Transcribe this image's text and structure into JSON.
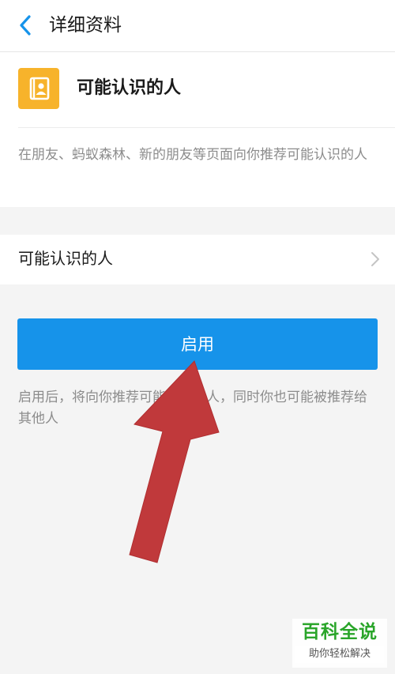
{
  "header": {
    "title": "详细资料"
  },
  "info_card": {
    "title": "可能认识的人",
    "description": "在朋友、蚂蚁森林、新的朋友等页面向你推荐可能认识的人"
  },
  "row": {
    "label": "可能认识的人"
  },
  "enable_button": {
    "label": "启用"
  },
  "enable_note": "启用后，将向你推荐可能认识的人，同时你也可能被推荐给其他人",
  "watermark": {
    "main": "百科全说",
    "sub": "助你轻松解决"
  },
  "colors": {
    "accent": "#1693ea",
    "icon_bg": "#f7b32b",
    "arrow": "#c0393b",
    "watermark_green": "#2aa52a"
  },
  "icons": {
    "back": "chevron-left-icon",
    "contact_book": "contact-book-icon",
    "row_chevron": "chevron-right-icon"
  }
}
